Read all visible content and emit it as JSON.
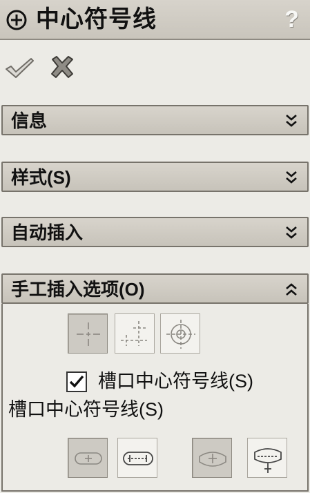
{
  "window": {
    "title": "中心符号线",
    "help_label": "?"
  },
  "actions": {
    "ok_icon": "check-icon",
    "cancel_icon": "close-icon"
  },
  "groups": {
    "info": {
      "label": "信息",
      "state": "collapsed"
    },
    "style": {
      "label": "样式(S)",
      "state": "collapsed"
    },
    "auto_insert": {
      "label": "自动插入",
      "state": "collapsed"
    },
    "manual_insert": {
      "label": "手工插入选项(O)",
      "state": "expanded"
    }
  },
  "manual": {
    "center_mark_types": [
      {
        "icon": "single-center-mark-icon",
        "selected": true
      },
      {
        "icon": "linear-center-mark-icon",
        "selected": false
      },
      {
        "icon": "circular-center-mark-icon",
        "selected": false
      }
    ],
    "slot_checkbox": {
      "label": "槽口中心符号线(S)",
      "checked": true
    },
    "slot_section_label": "槽口中心符号线(S)",
    "slot_types": [
      {
        "icon": "slot-center-icon",
        "selected": true
      },
      {
        "icon": "slot-ends-icon",
        "selected": false
      },
      {
        "icon": "arc-slot-center-icon",
        "selected": true
      },
      {
        "icon": "arc-slot-ends-icon",
        "selected": false
      }
    ]
  },
  "colors": {
    "titlebar": "#c9c5bc",
    "group_header": "#cfcbc3",
    "panel_bg": "#ecebe6",
    "border": "#77736b"
  }
}
